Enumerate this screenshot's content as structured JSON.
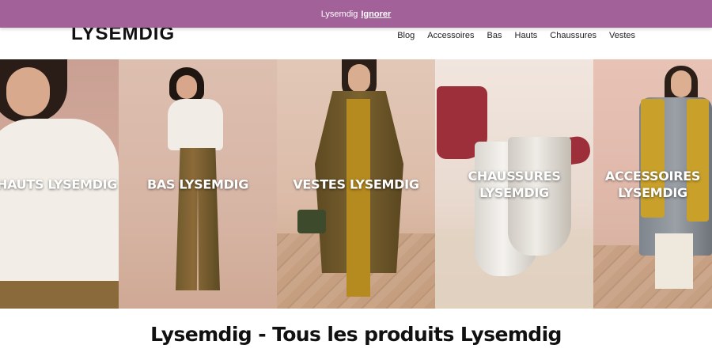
{
  "notice": {
    "text": "Lysemdig",
    "dismiss_label": "Ignorer"
  },
  "header": {
    "logo": "LYSEMDIG",
    "nav": [
      {
        "label": "Blog"
      },
      {
        "label": "Accessoires"
      },
      {
        "label": "Bas"
      },
      {
        "label": "Hauts"
      },
      {
        "label": "Chaussures"
      },
      {
        "label": "Vestes"
      }
    ]
  },
  "categories": [
    {
      "label": "HAUTS LYSEMDIG"
    },
    {
      "label": "BAS LYSEMDIG"
    },
    {
      "label": "VESTES LYSEMDIG"
    },
    {
      "label": "CHAUSSURES\nLYSEMDIG"
    },
    {
      "label": "ACCESSOIRES\nLYSEMDIG"
    }
  ],
  "page": {
    "title": "Lysemdig - Tous les produits Lysemdig"
  },
  "colors": {
    "notice_bar": "#a3619a",
    "background": "#ffffff",
    "title_text": "#111111"
  }
}
